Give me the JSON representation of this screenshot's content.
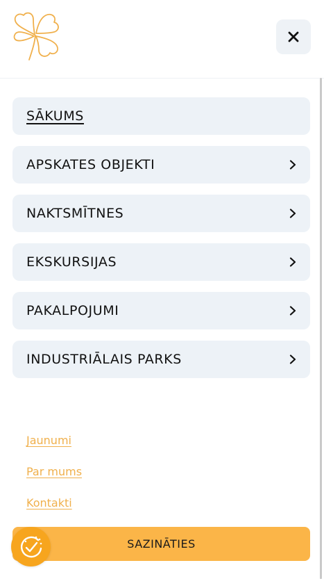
{
  "header": {
    "logo_icon": "clover-logo-icon",
    "close_icon": "close-icon",
    "accent_color": "#f0b04c"
  },
  "menu": {
    "items": [
      {
        "label": "SĀKUMS",
        "active": true
      },
      {
        "label": "APSKATES OBJEKTI",
        "active": false
      },
      {
        "label": "NAKTSMĪTNES",
        "active": false
      },
      {
        "label": "EKSKURSIJAS",
        "active": false
      },
      {
        "label": "PAKALPOJUMI",
        "active": false
      },
      {
        "label": "INDUSTRIĀLAIS PARKS",
        "active": false
      }
    ],
    "chevron_icon": "chevron-right-icon"
  },
  "footer": {
    "links": [
      {
        "label": "Jaunumi"
      },
      {
        "label": "Par mums"
      },
      {
        "label": "Kontakti"
      }
    ],
    "cta_label": "SAZINĀTIES",
    "cta_color": "#fbb548"
  },
  "cookie_badge": {
    "icon": "cookie-consent-icon",
    "color": "#f7a51e"
  }
}
